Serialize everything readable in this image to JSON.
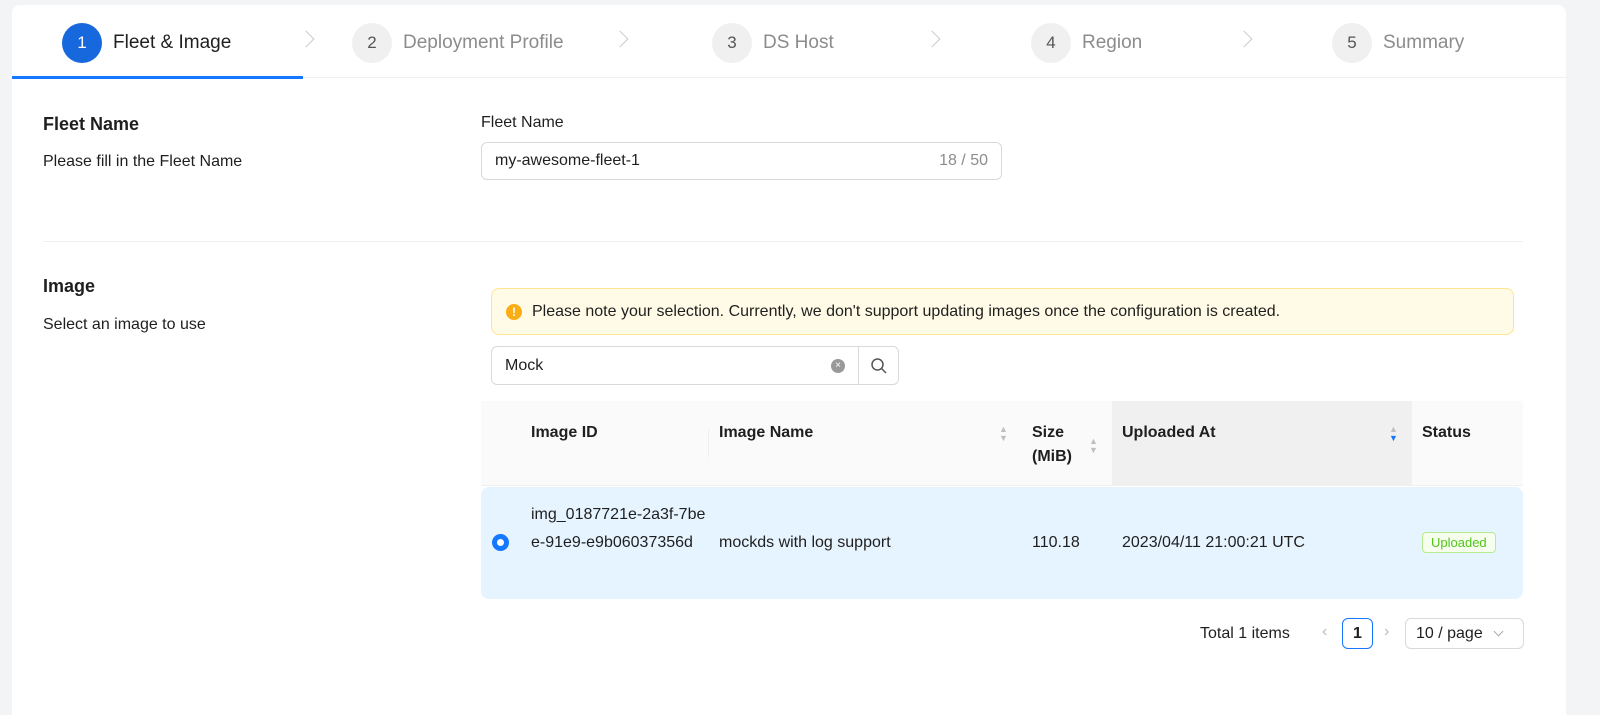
{
  "steps": [
    {
      "num": "1",
      "label": "Fleet & Image",
      "active": true
    },
    {
      "num": "2",
      "label": "Deployment Profile"
    },
    {
      "num": "3",
      "label": "DS Host"
    },
    {
      "num": "4",
      "label": "Region"
    },
    {
      "num": "5",
      "label": "Summary"
    }
  ],
  "fleet": {
    "title": "Fleet Name",
    "desc": "Please fill in the Fleet Name",
    "field_label": "Fleet Name",
    "value": "my-awesome-fleet-1",
    "count": "18 / 50"
  },
  "image": {
    "title": "Image",
    "desc": "Select an image to use",
    "alert": "Please note your selection. Currently, we don't support updating images once the configuration is created.",
    "search_value": "Mock"
  },
  "table": {
    "headers": {
      "id": "Image ID",
      "name": "Image Name",
      "size": "Size (MiB)",
      "uploaded": "Uploaded At",
      "status": "Status"
    },
    "rows": [
      {
        "id": "img_0187721e-2a3f-7bee-91e9-e9b06037356d",
        "name": "mockds with log support",
        "size": "110.18",
        "uploaded": "2023/04/11 21:00:21 UTC",
        "status": "Uploaded",
        "selected": true
      }
    ]
  },
  "pagination": {
    "total": "Total 1 items",
    "page": "1",
    "page_size": "10 / page"
  },
  "colors": {
    "primary": "#1677ff",
    "row_selected": "#e6f4ff",
    "warning_bg": "#fffbe6",
    "success": "#52c41a"
  }
}
